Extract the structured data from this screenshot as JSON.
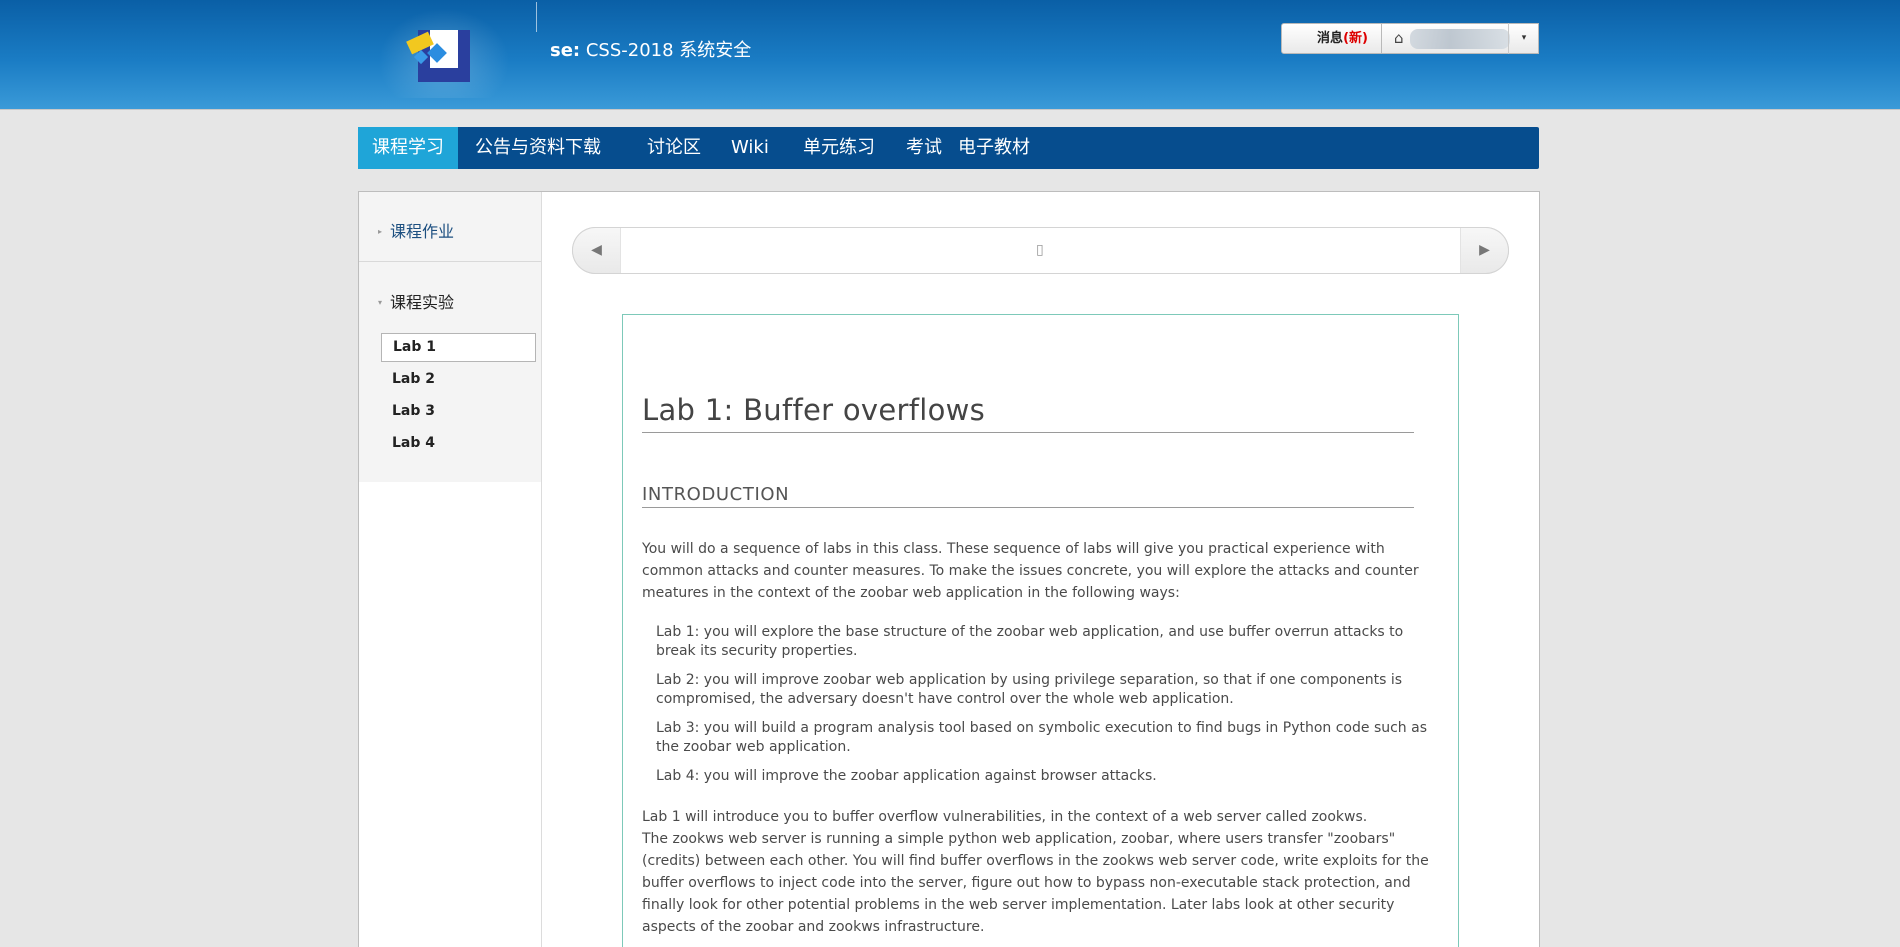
{
  "header": {
    "title_prefix": "se:",
    "title": "CSS-2018 系统安全",
    "messages_label": "消息",
    "messages_new": "(新)",
    "home_icon": "⌂",
    "dropdown_icon": "▾"
  },
  "nav": {
    "items": [
      "课程学习",
      "公告与资料下载",
      "讨论区",
      "Wiki",
      "单元练习",
      "考试",
      "电子教材"
    ],
    "active": "课程学习"
  },
  "sidebar": {
    "section1": "课程作业",
    "section2": "课程实验",
    "labs": [
      "Lab 1",
      "Lab 2",
      "Lab 3",
      "Lab 4"
    ],
    "active_lab": "Lab 1"
  },
  "pager": {
    "prev_icon": "◀",
    "next_icon": "▶",
    "page_icon": "▯"
  },
  "document": {
    "title": "Lab 1: Buffer overflows",
    "section_heading": "INTRODUCTION",
    "intro": "You will do a sequence of labs in this class. These sequence of labs will give you practical experience with common attacks and counter measures. To make the issues concrete, you will explore the attacks and counter meatures in the context of the zoobar web application in the following ways:",
    "list": [
      "Lab 1: you will explore the base structure of the zoobar web application, and use buffer overrun attacks to break its security properties.",
      "Lab 2: you will improve zoobar web application by using privilege separation, so that if one components is compromised, the adversary doesn't have control over the whole web application.",
      "Lab 3: you will build a program analysis tool based on symbolic execution to find bugs in Python code such as the zoobar web application.",
      "Lab 4: you will improve the zoobar application against browser attacks."
    ],
    "para2_line1": "Lab 1 will introduce you to buffer overflow vulnerabilities, in the context of a web server called zookws.",
    "para2_rest": "The zookws web server is running a simple python web application, zoobar, where users transfer \"zoobars\" (credits) between each other. You will find buffer overflows in the zookws web server code, write exploits for the buffer overflows to inject code into the server, figure out how to bypass non-executable stack protection, and finally look for other potential problems in the web server implementation. Later labs look at other security aspects of the zoobar and zookws infrastructure."
  }
}
